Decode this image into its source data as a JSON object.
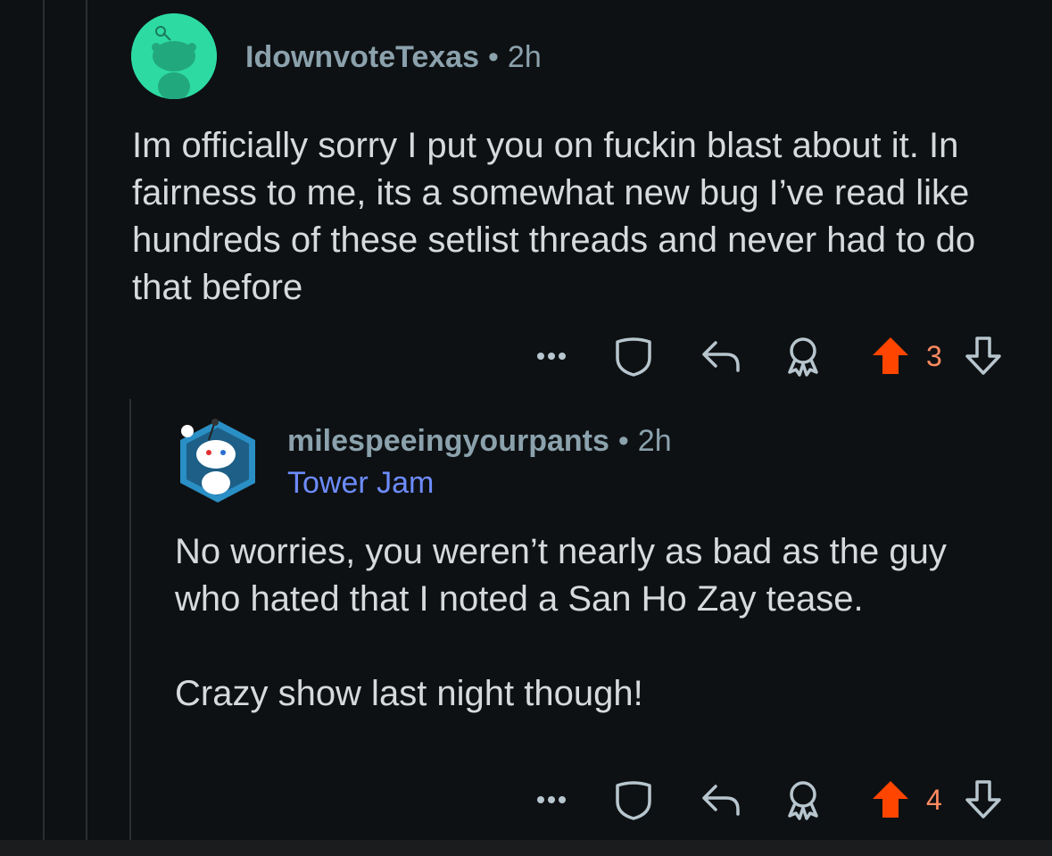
{
  "comments": [
    {
      "username": "IdownvoteTexas",
      "separator": "•",
      "time": "2h",
      "avatar_icon": "snoo-avatar-icon",
      "body": "Im officially sorry I put you on fuckin blast about it. In fairness to me, its a somewhat new bug I’ve read like hundreds of these setlist threads and never had to do that before",
      "score": "3",
      "upvoted": true
    },
    {
      "username": "milespeeingyourpants",
      "separator": "•",
      "time": "2h",
      "flair": "Tower Jam",
      "avatar_icon": "snoo-hex-avatar-icon",
      "body_paragraphs": [
        "No worries, you weren’t nearly as bad as the guy who hated that I noted a San Ho Zay tease.",
        "Crazy show last night though!"
      ],
      "score": "4",
      "upvoted": true
    }
  ],
  "colors": {
    "background": "#0e1113",
    "username": "#8ba2ad",
    "flair": "#6d8cff",
    "upvote": "#ff4500",
    "score": "#ff8b60",
    "icon": "#b7c6ce"
  }
}
